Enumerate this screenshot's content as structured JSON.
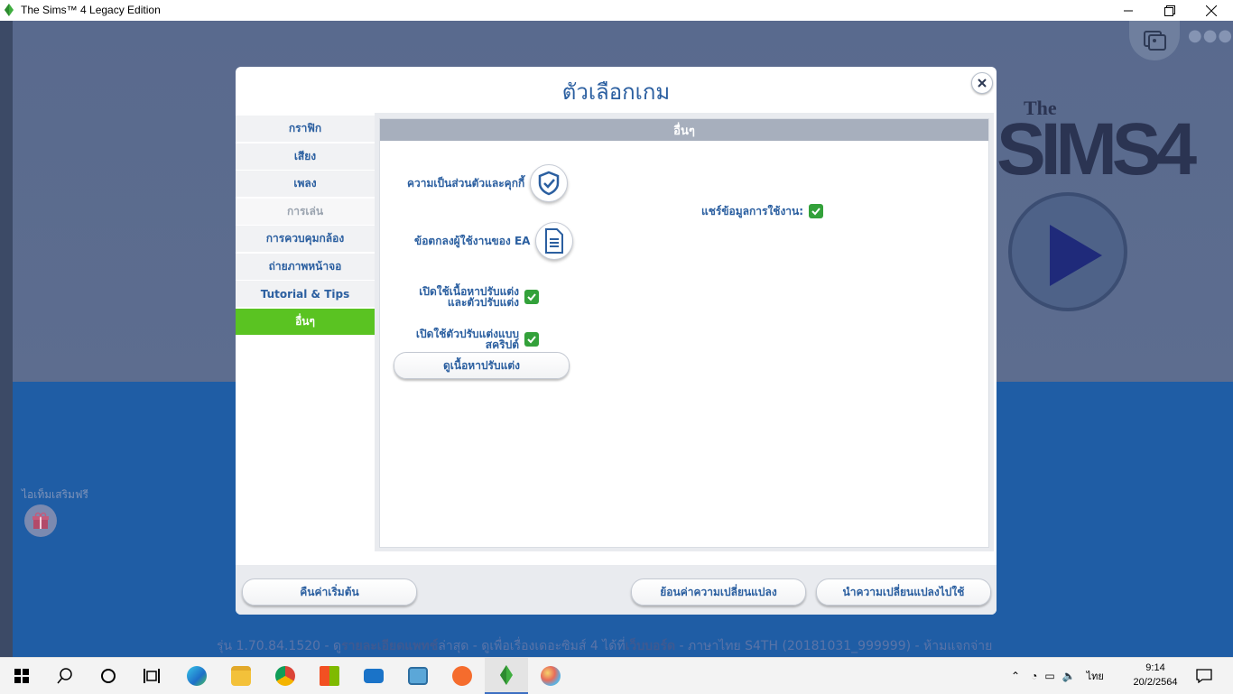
{
  "window": {
    "title": "The Sims™ 4 Legacy Edition"
  },
  "game": {
    "logo_the": "The",
    "logo_word": "SIMS4",
    "free_items_label": "ไอเท็มเสริมฟรี",
    "version_prefix": "รุ่น 1.70.84.1520 - ดู",
    "version_link1": "รายละเอียดแพทช์",
    "version_mid": "ล่าสุด - ดูเพื่อเรื่องเดอะซิมส์ 4 ได้ที่",
    "version_link2": "เว็บบอร์ด",
    "version_suffix": " - ภาษาไทย S4TH (20181031_999999) - ห้ามแจกจ่าย"
  },
  "dialog": {
    "title": "ตัวเลือกเกม",
    "sidebar": [
      {
        "label": "กราฟิก",
        "state": "normal"
      },
      {
        "label": "เสียง",
        "state": "normal"
      },
      {
        "label": "เพลง",
        "state": "normal"
      },
      {
        "label": "การเล่น",
        "state": "disabled"
      },
      {
        "label": "การควบคุมกล้อง",
        "state": "normal"
      },
      {
        "label": "ถ่ายภาพหน้าจอ",
        "state": "normal"
      },
      {
        "label": "Tutorial & Tips",
        "state": "normal"
      },
      {
        "label": "อื่นๆ",
        "state": "active"
      }
    ],
    "panel": {
      "header": "อื่นๆ",
      "privacy_label": "ความเป็นส่วนตัวและคุกกี้",
      "user_agreement_label": "ข้อตกลงผู้ใช้งานของ EA",
      "custom_content_label": "เปิดใช้เนื้อหาปรับแต่งและตัวปรับแต่ง",
      "custom_content_checked": true,
      "script_mods_label": "เปิดใช้ตัวปรับแต่งแบบสคริปต์",
      "script_mods_checked": true,
      "view_content_button": "ดูเนื้อหาปรับแต่ง",
      "share_usage_label": "แชร์ข้อมูลการใช้งาน:",
      "share_usage_checked": true
    },
    "footer": {
      "restore_defaults": "คืนค่าเริ่มต้น",
      "revert_changes": "ย้อนค่าความเปลี่ยนแปลง",
      "apply_changes": "นำความเปลี่ยนแปลงไปใช้"
    }
  },
  "taskbar": {
    "language": "ไทย",
    "time": "9:14",
    "date": "20/2/2564"
  }
}
